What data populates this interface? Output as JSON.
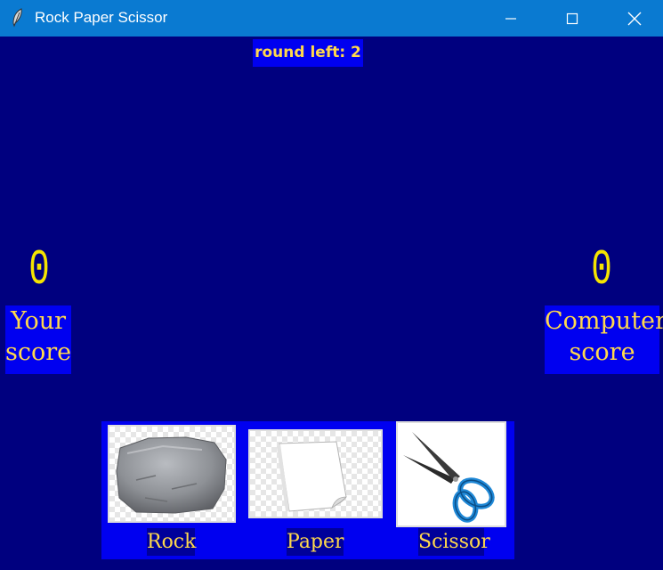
{
  "window": {
    "title": "Rock Paper Scissor"
  },
  "game": {
    "round_left": "round left: 2",
    "your_score": "0",
    "computer_score": "0",
    "your_score_label": "Your score",
    "computer_score_label": "Computer score"
  },
  "choices": [
    {
      "label": "Rock"
    },
    {
      "label": "Paper"
    },
    {
      "label": "Scissor"
    }
  ]
}
